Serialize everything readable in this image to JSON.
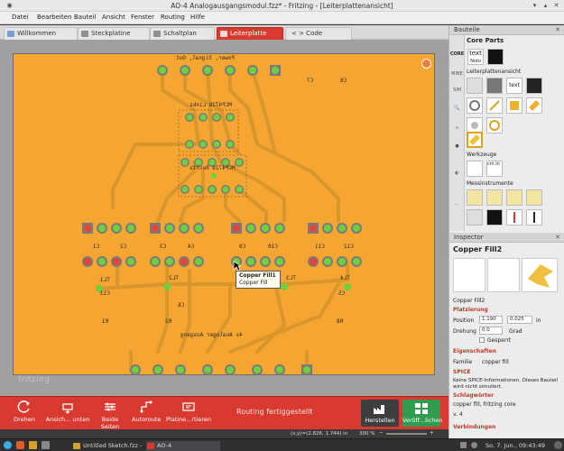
{
  "window": {
    "title": "AO-4 Analogausgangsmodul.fzz* - Fritzing - [Leiterplattenansicht]"
  },
  "menu": [
    "Datei",
    "Bearbeiten",
    "Bauteil",
    "Ansicht",
    "Fenster",
    "Routing",
    "Hilfe"
  ],
  "tabs": [
    {
      "label": "Willkommen",
      "active": false
    },
    {
      "label": "Steckplatine",
      "active": false
    },
    {
      "label": "Schaltplan",
      "active": false
    },
    {
      "label": "Leiterplatte",
      "active": true
    },
    {
      "label": "< > Code",
      "active": false
    }
  ],
  "pcb": {
    "labels": {
      "header_top": "Power, Signal, Out",
      "chip1": "MCP4728 Links",
      "chip2": "MCP4728 Rechts",
      "bottom": "4x Analoger Ausgang",
      "c7": "C7",
      "c8": "C8",
      "c1": "C1",
      "c2": "C2",
      "c3": "C3",
      "c4": "C4",
      "c9": "C9",
      "r1": "R1",
      "r8": "R8",
      "c5": "C5",
      "c6": "C6",
      "c10": "C10",
      "c11": "C11",
      "c12": "C12",
      "tl1": "TL1",
      "tl2": "TL2",
      "tl3": "TL3",
      "tl4": "TL4",
      "r2": "R2",
      "c13": "C13"
    },
    "watermark": "fritzing"
  },
  "tooltip": {
    "title": "Copper Fill1",
    "subtitle": "Copper Fill"
  },
  "toolbar": {
    "buttons": [
      "Drehen",
      "Ansich... unten",
      "Beide Seiten",
      "Autoroute",
      "Platine...rtieren"
    ],
    "status": "Routing fertiggestellt",
    "export": "Herstellen",
    "share": "Veröff...lichen"
  },
  "statusbar": {
    "coords": "(x,y)=(2.826, 1.744) in",
    "zoom": "300 %"
  },
  "bauteile": {
    "title": "Bauteile",
    "section": "Core Parts",
    "bin_tabs": [
      "CORE",
      "MINE",
      "SIM"
    ],
    "view_label": "Leiterplattenansicht",
    "tools_label": "Werkzeuge",
    "instruments_label": "Messinstrumente",
    "text_item": "text",
    "note_item": "Noto"
  },
  "inspector": {
    "title": "Inspector",
    "part_name": "Copper Fill2",
    "part_title": "Copper Fill2",
    "placement_header": "Platzierung",
    "position_label": "Position",
    "pos_x": "1.190",
    "pos_y": "0.025",
    "pos_unit": "in",
    "rotation_label": "Drehung",
    "rotation_value": "0.0",
    "rotation_unit": "Grad",
    "locked_label": "Gesperrt",
    "props_header": "Eigenschaften",
    "family_label": "Familie",
    "family_value": "copper fill",
    "spice_header": "SPICE",
    "spice_text": "Keine SPICE-Informationen. Dieses Bauteil wird nicht simuliert.",
    "tags_header": "Schlagwörter",
    "tags_value": "copper fill, fritzing core",
    "version": "v. 4",
    "connections_header": "Verbindungen"
  },
  "taskbar": {
    "items": [
      "Untitled Sketch.fzz - ...",
      "AO-4 Analogausgan..."
    ],
    "clock": "So, 7. Jun., 09:43:49"
  },
  "colors": {
    "accent": "#d83a2f",
    "board": "#f5a531",
    "trace": "#d9962b",
    "pad_green": "#6fcf3f",
    "pad_red": "#e0463a"
  }
}
